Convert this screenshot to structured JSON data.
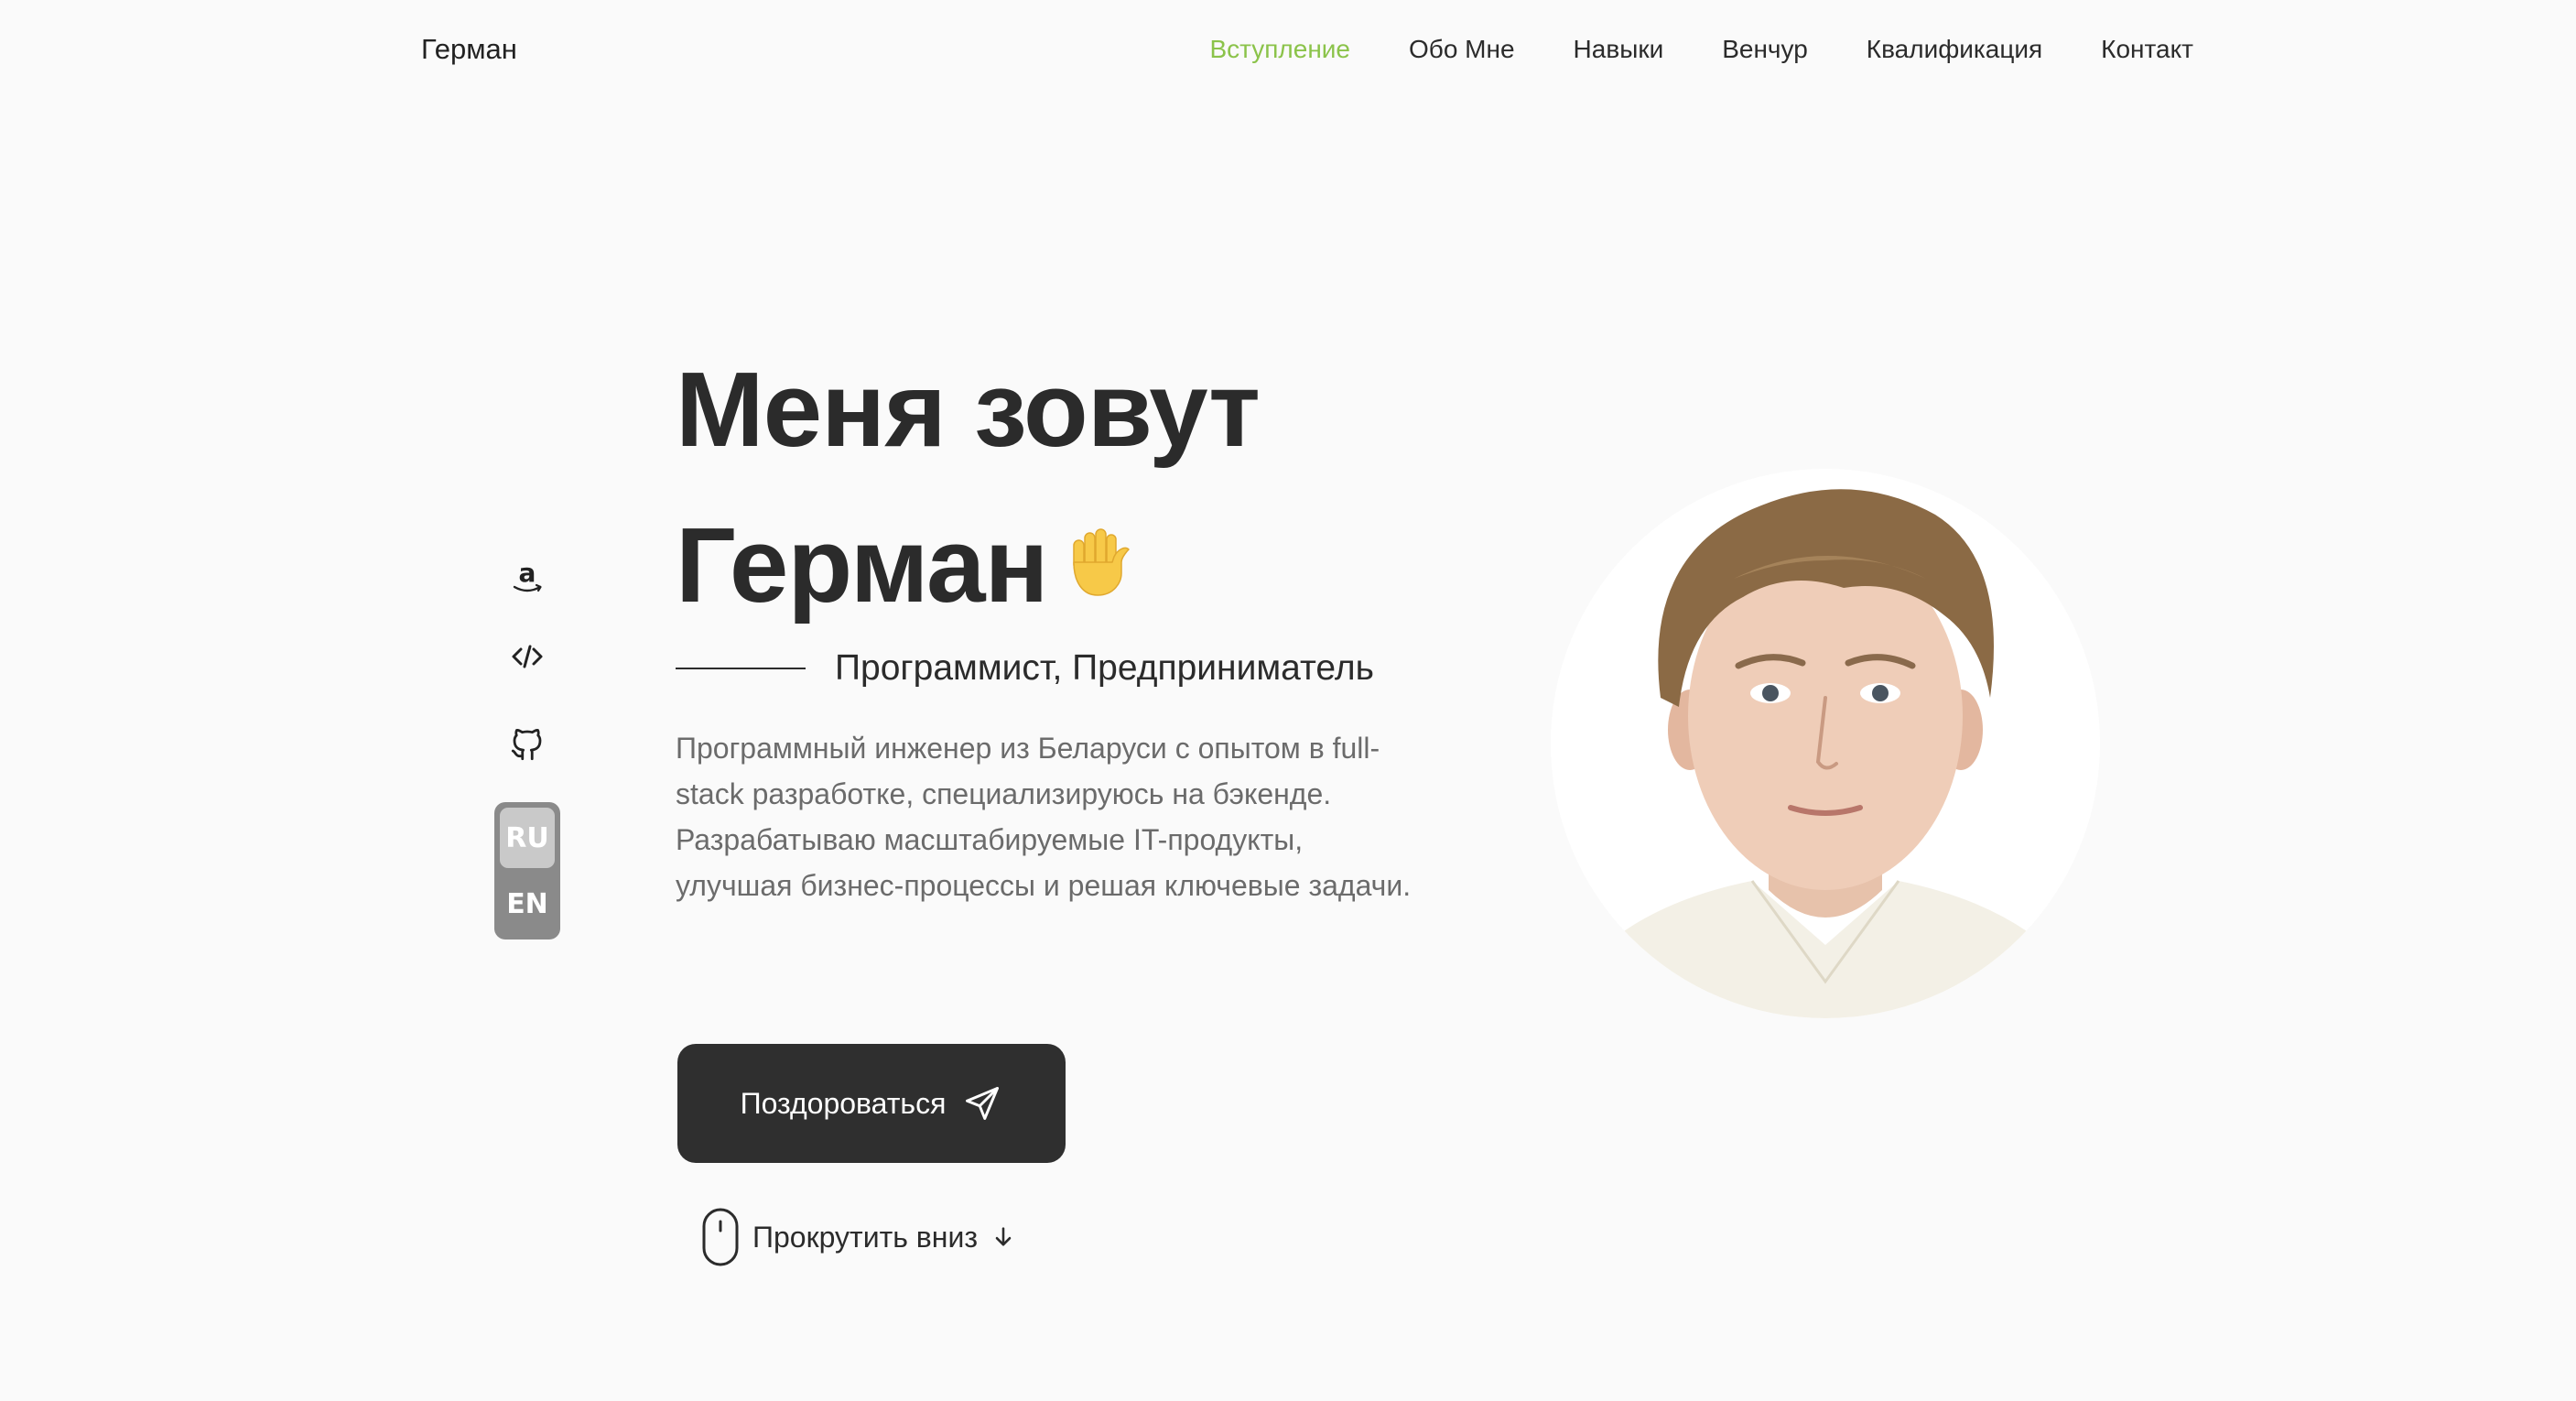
{
  "header": {
    "logo": "Герман",
    "nav": [
      {
        "label": "Вступление",
        "active": true
      },
      {
        "label": "Обо Мне",
        "active": false
      },
      {
        "label": "Навыки",
        "active": false
      },
      {
        "label": "Венчур",
        "active": false
      },
      {
        "label": "Квалификация",
        "active": false
      },
      {
        "label": "Контакт",
        "active": false
      }
    ]
  },
  "socials": [
    {
      "icon": "amazon-icon"
    },
    {
      "icon": "code-icon"
    },
    {
      "icon": "github-icon"
    }
  ],
  "language": {
    "options": [
      "RU",
      "EN"
    ],
    "selected": "RU"
  },
  "hero": {
    "title_line1": "Меня зовут",
    "title_line2": "Герман",
    "subtitle": "Программист, Предприниматель",
    "description": "Программный инженер из Беларуси с опытом в full-stack разработке, специализируюсь на бэкенде. Разрабатываю масштабируемые IT-продукты, улучшая бизнес-процессы и решая ключевые задачи.",
    "cta_label": "Поздороваться",
    "scroll_label": "Прокрутить вниз"
  },
  "colors": {
    "accent": "#8bc34a",
    "button_bg": "#2f2f2f",
    "text": "#2b2b2b",
    "muted_text": "#6b6b6b",
    "background": "#fafafa"
  }
}
